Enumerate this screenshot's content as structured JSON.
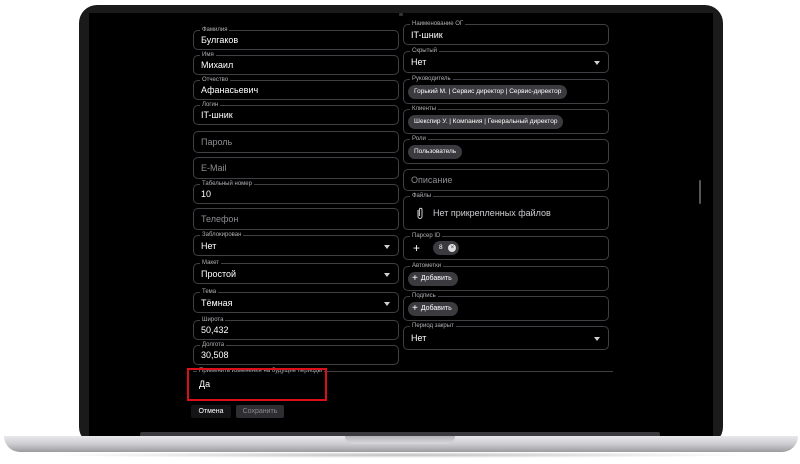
{
  "form": {
    "left": [
      {
        "label": "Фамилия",
        "value": "Булгаков"
      },
      {
        "label": "Имя",
        "value": "Михаил"
      },
      {
        "label": "Отчество",
        "value": "Афанасьевич"
      },
      {
        "label": "Логин",
        "value": "IT-шник"
      },
      {
        "placeholder": "Пароль"
      },
      {
        "placeholder": "E-Mail"
      },
      {
        "label": "Табельный номер",
        "value": "10"
      },
      {
        "placeholder": "Телефон"
      },
      {
        "label": "Заблокирован",
        "value": "Нет"
      },
      {
        "label": "Макет",
        "value": "Простой"
      },
      {
        "label": "Тема",
        "value": "Тёмная"
      },
      {
        "label": "Широта",
        "value": "50,432"
      },
      {
        "label": "Долгота",
        "value": "30,508"
      }
    ],
    "right": {
      "unit": {
        "label": "Наименование ОГ",
        "value": "IT-шник"
      },
      "hidden": {
        "label": "Скрытый",
        "value": "Нет"
      },
      "manager": {
        "label": "Руководитель",
        "chip": "Горький М. | Сервис директор | Сервис-директор"
      },
      "clients": {
        "label": "Клиенты",
        "chip": "Шекспир У. | Компания | Генеральный директор"
      },
      "roles": {
        "label": "Роли",
        "chip": "Пользователь"
      },
      "description": {
        "placeholder": "Описание"
      },
      "files": {
        "label": "Файлы",
        "empty_text": "Нет прикрепленных файлов"
      },
      "parser": {
        "label": "Парсер ID",
        "chip": "8"
      },
      "automarks": {
        "label": "Автометки",
        "add_label": "Добавить"
      },
      "signature": {
        "label": "Подпись",
        "add_label": "Добавить"
      },
      "period": {
        "label": "Период закрыт",
        "value": "Нет"
      }
    },
    "apply_future": {
      "label": "Применить изменения на будущие периоды",
      "value": "Да"
    }
  },
  "actions": {
    "cancel": "Отмена",
    "save": "Сохранить"
  },
  "colors": {
    "background": "#000000",
    "field_border": "#3f3f44",
    "chip": "#3b3b3f",
    "highlight": "#d9101a"
  },
  "icons": {
    "caret": "chevron-down-icon",
    "paperclip": "paperclip-icon",
    "plus": "plus-icon",
    "remove": "close-circle-icon"
  }
}
